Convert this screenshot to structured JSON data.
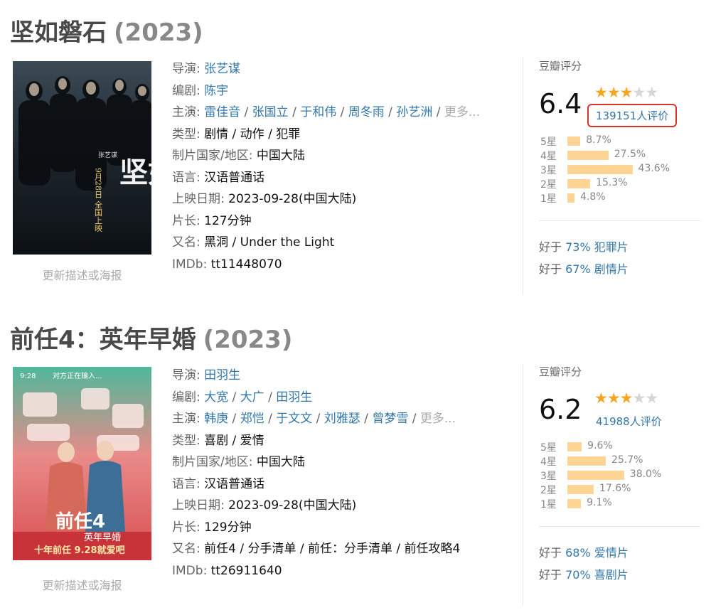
{
  "colors": {
    "link": "#3377aa",
    "star": "#f4a623",
    "bar": "#ffd596",
    "highlight_box": "#d9342b"
  },
  "movies": [
    {
      "title": "坚如磐石",
      "year": "(2023)",
      "update_link": "更新描述或海报",
      "poster": {
        "text": "坚如磐石",
        "caption": "9月28日 全国上映",
        "director": "张艺谋"
      },
      "director": {
        "label": "导演:",
        "names": [
          "张艺谋"
        ]
      },
      "writer": {
        "label": "编剧:",
        "names": [
          "陈宇"
        ]
      },
      "cast": {
        "label": "主演:",
        "names": [
          "雷佳音",
          "张国立",
          "于和伟",
          "周冬雨",
          "孙艺洲"
        ],
        "more": "更多..."
      },
      "genre": {
        "label": "类型:",
        "value": "剧情 / 动作 / 犯罪"
      },
      "country": {
        "label": "制片国家/地区:",
        "value": "中国大陆"
      },
      "language": {
        "label": "语言:",
        "value": "汉语普通话"
      },
      "release": {
        "label": "上映日期:",
        "value": "2023-09-28(中国大陆)"
      },
      "runtime": {
        "label": "片长:",
        "value": "127分钟"
      },
      "aka": {
        "label": "又名:",
        "value": "黑洞 / Under the Light"
      },
      "imdb": {
        "label": "IMDb:",
        "value": "tt11448070"
      },
      "rating": {
        "title": "豆瓣评分",
        "score": "6.4",
        "stars_filled": 3,
        "stars_total": 5,
        "votes": "139151人评价",
        "votes_highlighted": true,
        "breakdown": [
          {
            "label": "5星",
            "percent": 8.7,
            "text": "8.7%"
          },
          {
            "label": "4星",
            "percent": 27.5,
            "text": "27.5%"
          },
          {
            "label": "3星",
            "percent": 43.6,
            "text": "43.6%"
          },
          {
            "label": "2星",
            "percent": 15.3,
            "text": "15.3%"
          },
          {
            "label": "1星",
            "percent": 4.8,
            "text": "4.8%"
          }
        ],
        "better_than": [
          {
            "prefix": "好于",
            "link": "73% 犯罪片"
          },
          {
            "prefix": "好于",
            "link": "67% 剧情片"
          }
        ]
      }
    },
    {
      "title": "前任4：英年早婚",
      "year": "(2023)",
      "update_link": "更新描述或海报",
      "poster": {
        "top": "对方正在输入...",
        "time": "9:28",
        "logo": "前任4",
        "sub": "英年早婚",
        "caption": "十年前任 9.28就爱吧"
      },
      "director": {
        "label": "导演:",
        "names": [
          "田羽生"
        ]
      },
      "writer": {
        "label": "编剧:",
        "names": [
          "大宽",
          "大广",
          "田羽生"
        ]
      },
      "cast": {
        "label": "主演:",
        "names": [
          "韩庚",
          "郑恺",
          "于文文",
          "刘雅瑟",
          "曾梦雪"
        ],
        "more": "更多..."
      },
      "genre": {
        "label": "类型:",
        "value": "喜剧 / 爱情"
      },
      "country": {
        "label": "制片国家/地区:",
        "value": "中国大陆"
      },
      "language": {
        "label": "语言:",
        "value": "汉语普通话"
      },
      "release": {
        "label": "上映日期:",
        "value": "2023-09-28(中国大陆)"
      },
      "runtime": {
        "label": "片长:",
        "value": "129分钟"
      },
      "aka": {
        "label": "又名:",
        "value": "前任4 / 分手清单 / 前任：分手清单 / 前任攻略4"
      },
      "imdb": {
        "label": "IMDb:",
        "value": "tt26911640"
      },
      "rating": {
        "title": "豆瓣评分",
        "score": "6.2",
        "stars_filled": 3,
        "stars_total": 5,
        "votes": "41988人评价",
        "votes_highlighted": false,
        "breakdown": [
          {
            "label": "5星",
            "percent": 9.6,
            "text": "9.6%"
          },
          {
            "label": "4星",
            "percent": 25.7,
            "text": "25.7%"
          },
          {
            "label": "3星",
            "percent": 38.0,
            "text": "38.0%"
          },
          {
            "label": "2星",
            "percent": 17.6,
            "text": "17.6%"
          },
          {
            "label": "1星",
            "percent": 9.1,
            "text": "9.1%"
          }
        ],
        "better_than": [
          {
            "prefix": "好于",
            "link": "68% 爱情片"
          },
          {
            "prefix": "好于",
            "link": "70% 喜剧片"
          }
        ]
      }
    }
  ]
}
